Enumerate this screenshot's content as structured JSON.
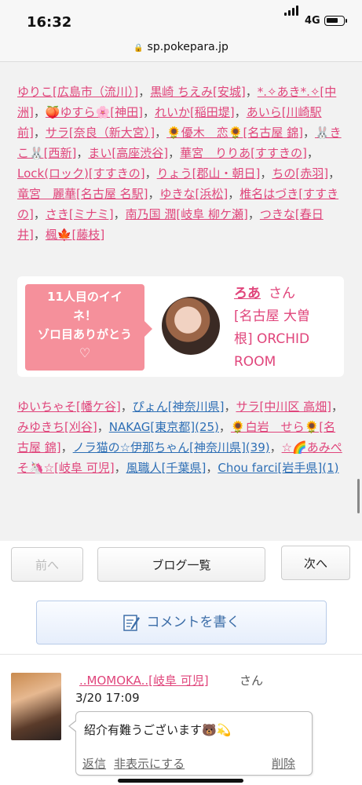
{
  "status": {
    "time": "16:32",
    "network": "4G"
  },
  "url": "sp.pokepara.jp",
  "list1": [
    {
      "t": "ゆりこ[広島市（流川）]"
    },
    {
      "t": "黒崎 ちえみ[安城]"
    },
    {
      "t": "*.✧あき*.✧[中洲]"
    },
    {
      "t": "🍑ゆすら🌸[神田]"
    },
    {
      "t": "れいか[稲田堤]"
    },
    {
      "t": "あいら[川崎駅前]"
    },
    {
      "t": "サラ[奈良（新大宮）]"
    },
    {
      "t": "🌻優木　恋🌻[名古屋 錦]"
    },
    {
      "t": "🐰きこ🐰[西新]"
    },
    {
      "t": "まい[高座渋谷]"
    },
    {
      "t": "華宮　りりあ[すすきの]"
    },
    {
      "t": "Lock(ロック)[すすきの]"
    },
    {
      "t": "りょう[郡山・朝日]"
    },
    {
      "t": "ちの[赤羽]"
    },
    {
      "t": "竜宮　麗華[名古屋 名駅]"
    },
    {
      "t": "ゆきな[浜松]"
    },
    {
      "t": "椎名はづき[すすきの]"
    },
    {
      "t": "さき[ミナミ]"
    },
    {
      "t": "南乃国 潤[岐阜 柳ケ瀬]"
    },
    {
      "t": "つきな[春日井]"
    },
    {
      "t": "楓🍁[藤枝]"
    }
  ],
  "card": {
    "message_line1": "11人目のイイ",
    "message_line2": "ネ！",
    "message_line3": "ゾロ目ありがとう",
    "heart": "♡",
    "name": "ろあ",
    "san": "さん",
    "store_line1": "[名古屋 大曽",
    "store_line2": "根] ORCHID",
    "store_line3": "ROOM"
  },
  "list2": [
    {
      "t": "ゆいちゃそ[幡ケ谷]",
      "c": "pink"
    },
    {
      "t": "ぴょん[神奈川県]",
      "c": "blue"
    },
    {
      "t": "サラ[中川区 高畑]",
      "c": "pink"
    },
    {
      "t": "みゆきち[刈谷]",
      "c": "pink"
    },
    {
      "t": "NAKAG[東京都](25)",
      "c": "blue"
    },
    {
      "t": "🌻白岩　せら🌻[名古屋 錦]",
      "c": "pink"
    },
    {
      "t": "ノラ猫の☆伊那ちゃん[神奈川県](39)",
      "c": "blue"
    },
    {
      "t": "☆🌈あみぺそ🦄☆[岐阜 可児]",
      "c": "pink"
    },
    {
      "t": "風職人[千葉県]",
      "c": "blue"
    },
    {
      "t": "Chou farci[岩手県](1)",
      "c": "blue"
    }
  ],
  "nav": {
    "prev": "前へ",
    "list": "ブログ一覧",
    "next": "次へ"
  },
  "compose": "コメントを書く",
  "comment": {
    "name": "..MOMOKA..[岐阜 可児]",
    "san": "さん",
    "date": "3/20 17:09",
    "message": "紹介有難うございます🐻💫",
    "reply": "返信",
    "hide": "非表示にする",
    "delete": "削除"
  }
}
